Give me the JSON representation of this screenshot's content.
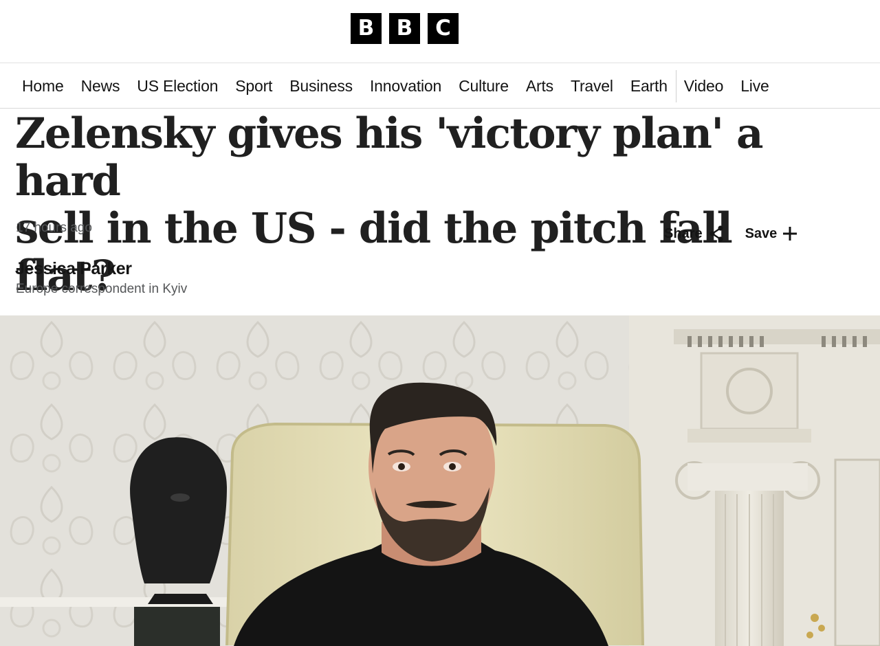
{
  "logo": {
    "letters": [
      "B",
      "B",
      "C"
    ]
  },
  "nav": {
    "items": [
      {
        "label": "Home"
      },
      {
        "label": "News"
      },
      {
        "label": "US Election"
      },
      {
        "label": "Sport"
      },
      {
        "label": "Business"
      },
      {
        "label": "Innovation"
      },
      {
        "label": "Culture"
      },
      {
        "label": "Arts"
      },
      {
        "label": "Travel"
      },
      {
        "label": "Earth"
      },
      {
        "label": "Video"
      },
      {
        "label": "Live"
      }
    ]
  },
  "article": {
    "headline_line1": "Zelensky gives his 'victory plan' a hard",
    "headline_line2": "sell in the US - did the pitch fall flat?",
    "timestamp": "17 hours ago",
    "share_label": "Share",
    "save_label": "Save",
    "author_name": "Jessica Parker",
    "author_role": "Europe correspondent in Kyiv",
    "hero_image_icon": "photo-of-zelensky-in-oval-office"
  },
  "colors": {
    "brand_black": "#000000",
    "text_primary": "#141414",
    "text_secondary": "#545658",
    "headline": "#202020"
  }
}
